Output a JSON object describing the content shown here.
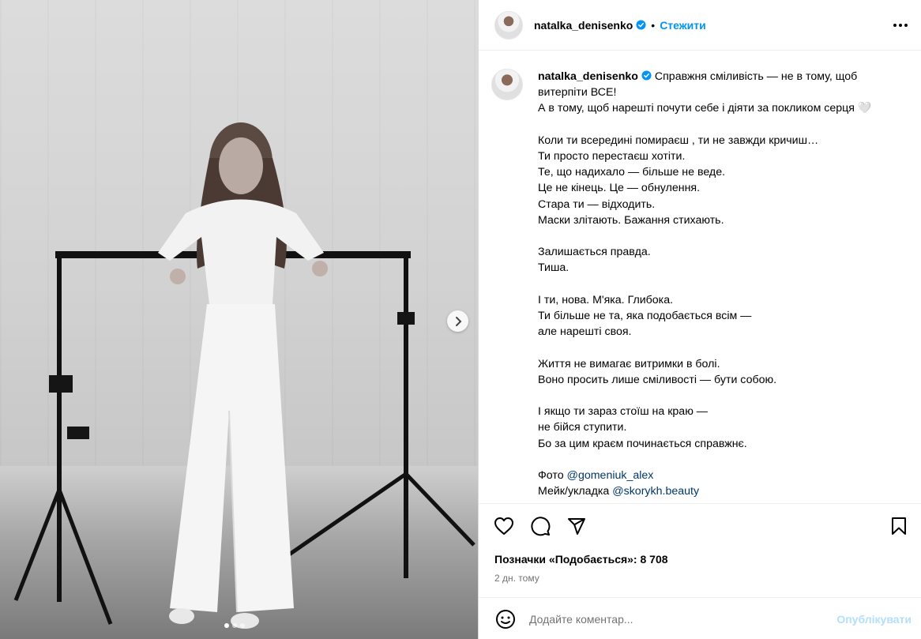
{
  "post": {
    "username": "natalka_denisenko",
    "follow_label": "Стежити",
    "separator": "•",
    "photo_count": 3,
    "active_photo": 1
  },
  "caption": {
    "username": "natalka_denisenko",
    "lines": [
      "Справжня сміливість — не в тому, щоб",
      "витерпіти ВСЕ!",
      "А в тому, щоб нарешті почути себе і діяти за покликом серця 🤍",
      "",
      "Коли ти всередині помираєш , ти не завжди кричиш…",
      "Ти просто перестаєш хотіти.",
      "Те, що надихало — більше не веде.",
      "Це не кінець. Це — обнулення.",
      "Стара ти — відходить.",
      "Маски злітають. Бажання стихають.",
      "",
      "Залишається правда.",
      "Тиша.",
      "",
      "І ти, нова. М'яка. Глибока.",
      "Ти більше не та, яка подобається всім —",
      "але нарешті своя.",
      "",
      "Життя не вимагає витримки в болі.",
      "Воно просить лише сміливості — бути собою.",
      "",
      "І якщо ти зараз стоїш на краю —",
      "не бійся ступити.",
      "Бо за цим краєм починається справжнє.",
      ""
    ],
    "credit_photo_label": "Фото",
    "credit_photo_mention": "@gomeniuk_alex",
    "credit_makeup_label": "Мейк/укладка",
    "credit_makeup_mention": "@skorykh.beauty"
  },
  "likes_text": "Позначки «Подобається»: 8 708",
  "time_text": "2 дн. тому",
  "comment": {
    "placeholder": "Додайте коментар...",
    "publish_label": "Опублікувати"
  },
  "colors": {
    "accent": "#0095f6",
    "mention": "#00376b",
    "publish_disabled": "#b2dffc",
    "muted": "#737373"
  },
  "icons": [
    "more-icon",
    "verified-icon",
    "heart-icon",
    "comment-icon",
    "share-icon",
    "bookmark-icon",
    "emoji-icon",
    "chevron-right-icon"
  ]
}
